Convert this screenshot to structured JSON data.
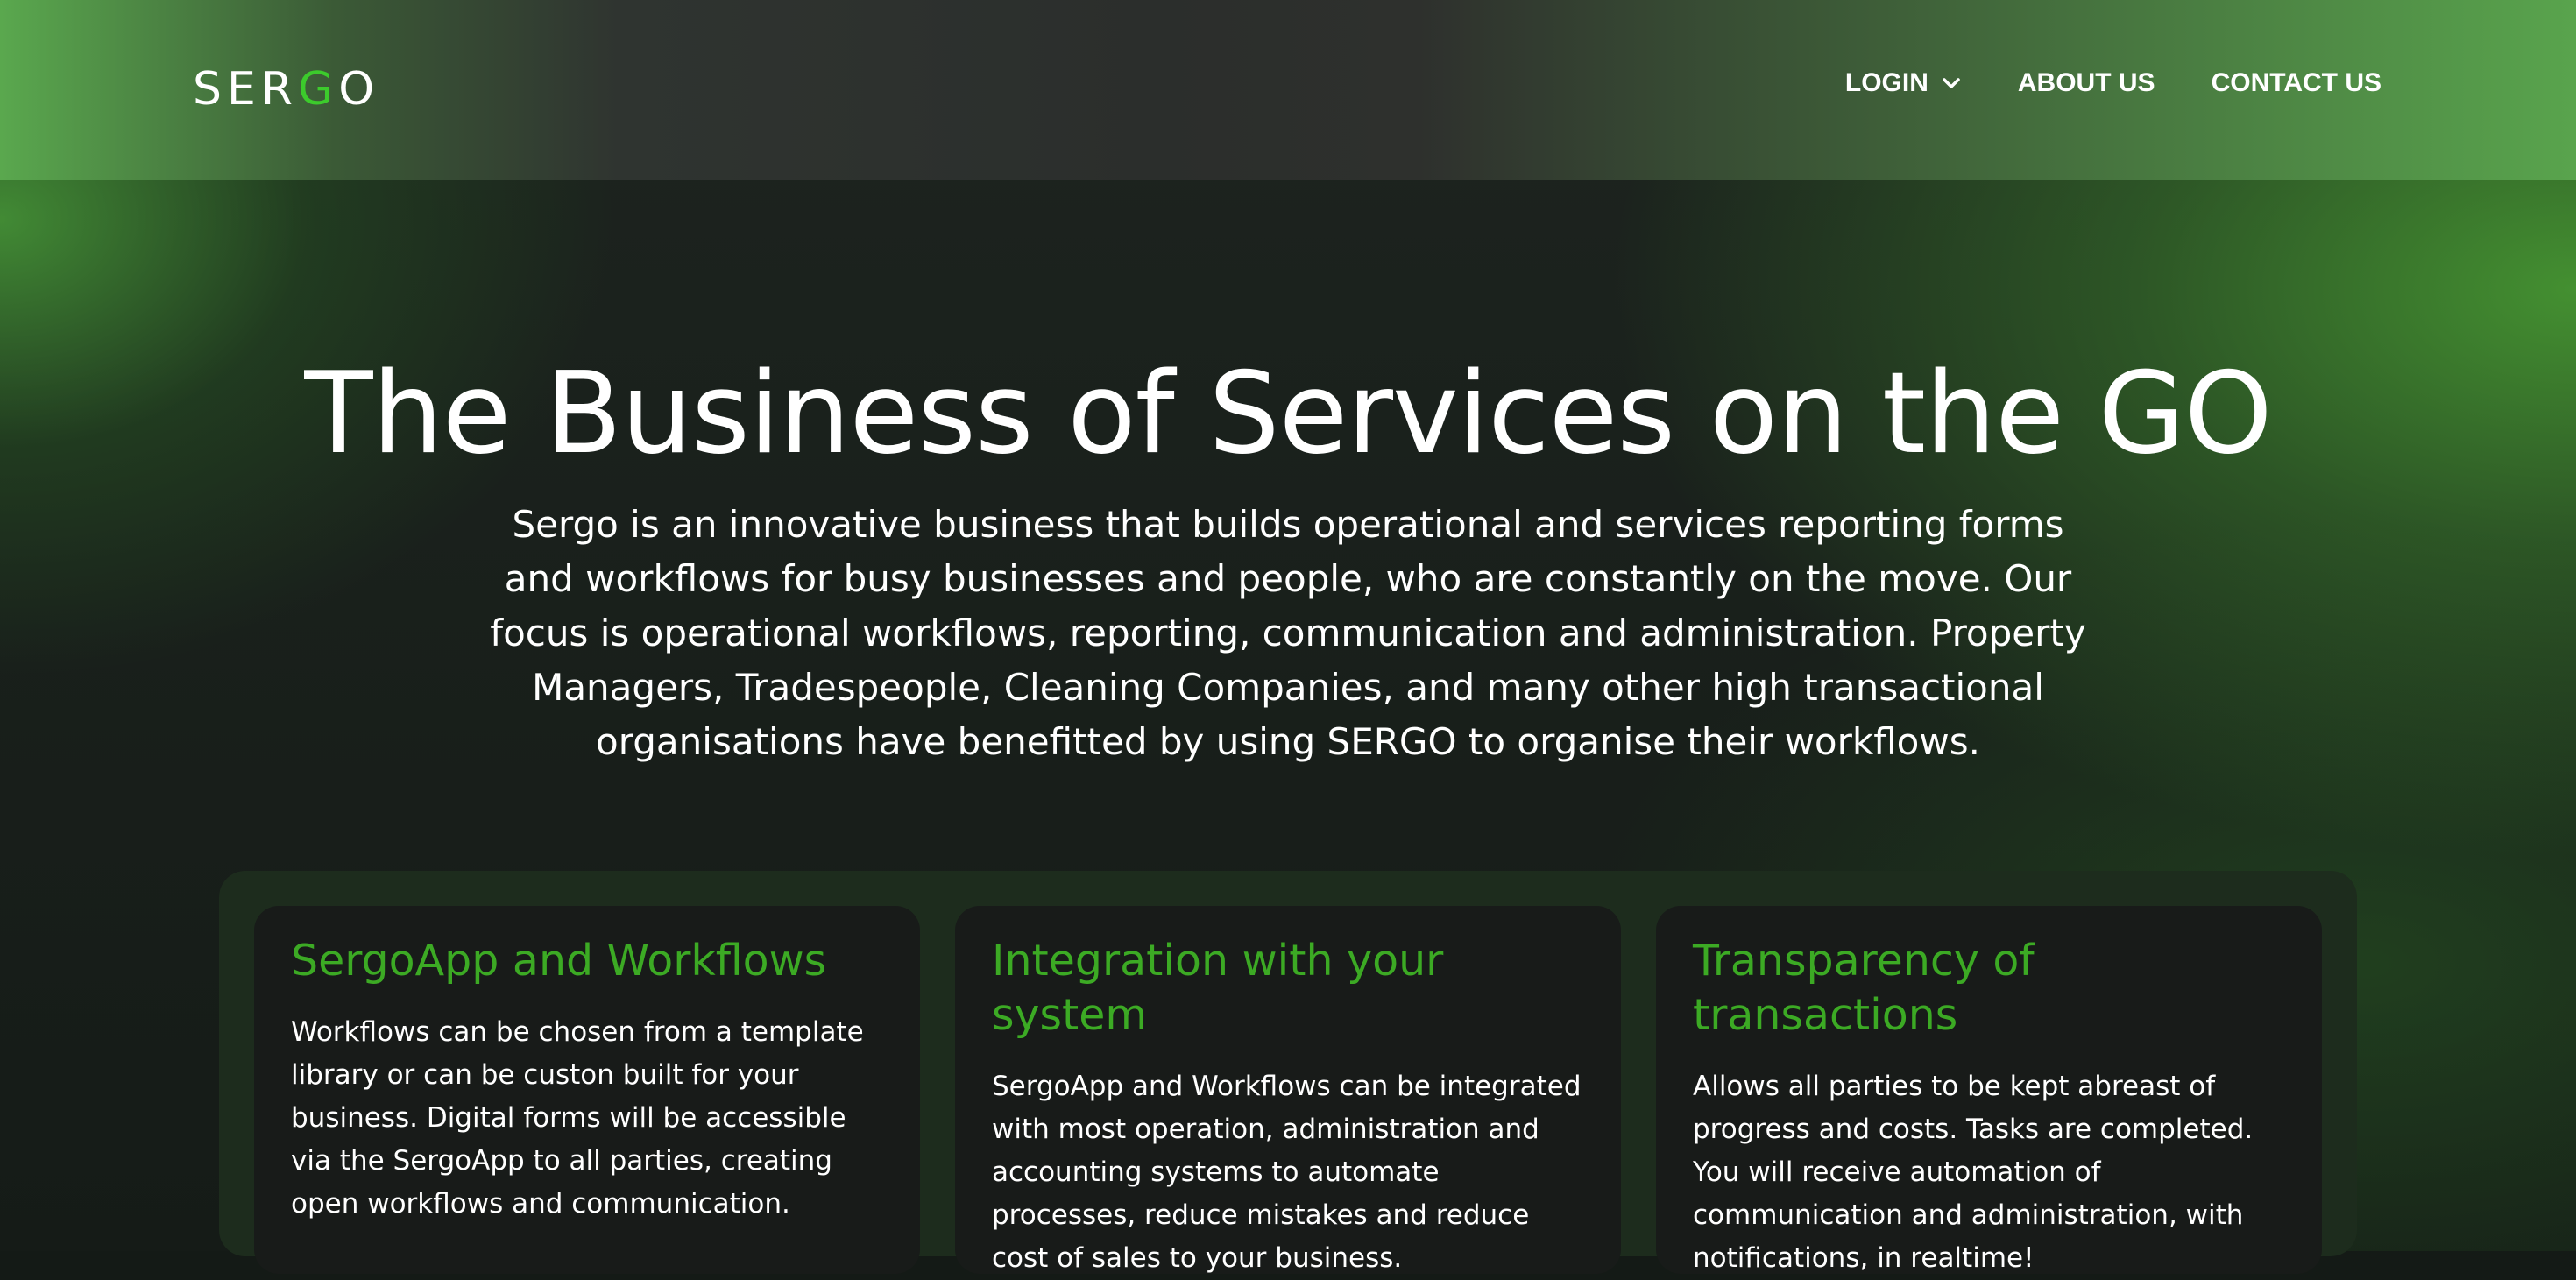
{
  "brand": {
    "logo_prefix": "SER",
    "logo_accent": "G",
    "logo_suffix": "O",
    "accent_color": "#3ccb2c"
  },
  "nav": {
    "login_label": "LOGIN",
    "about_label": "ABOUT US",
    "contact_label": "CONTACT US"
  },
  "hero": {
    "title": "The Business of Services on the GO",
    "description": "Sergo is an innovative business that builds operational and services reporting forms and workflows  for busy businesses and people, who are constantly on the move. Our focus is operational workflows, reporting, communication and administration. Property Managers, Tradespeople, Cleaning Companies, and many other high transactional organisations have benefitted by using SERGO to organise their workflows."
  },
  "features": [
    {
      "title": "SergoApp and Workflows",
      "body": "Workflows can be chosen from a template library or can be custon built for your business. Digital forms will be accessible via the SergoApp to all parties, creating open workflows and communication."
    },
    {
      "title": "Integration with your system",
      "body": "SergoApp and Workflows can be integrated with most operation, administration and accounting systems to automate processes, reduce mistakes and reduce cost of sales to your business."
    },
    {
      "title": "Transparency of transactions",
      "body": "Allows all parties to be kept abreast of progress and costs. Tasks are completed. You will receive automation of communication and administration, with notifications, in realtime!"
    }
  ],
  "colors": {
    "feature_title": "#3caa24",
    "card_bg": "#181b19",
    "panel_bg": "#1d2c1d"
  }
}
